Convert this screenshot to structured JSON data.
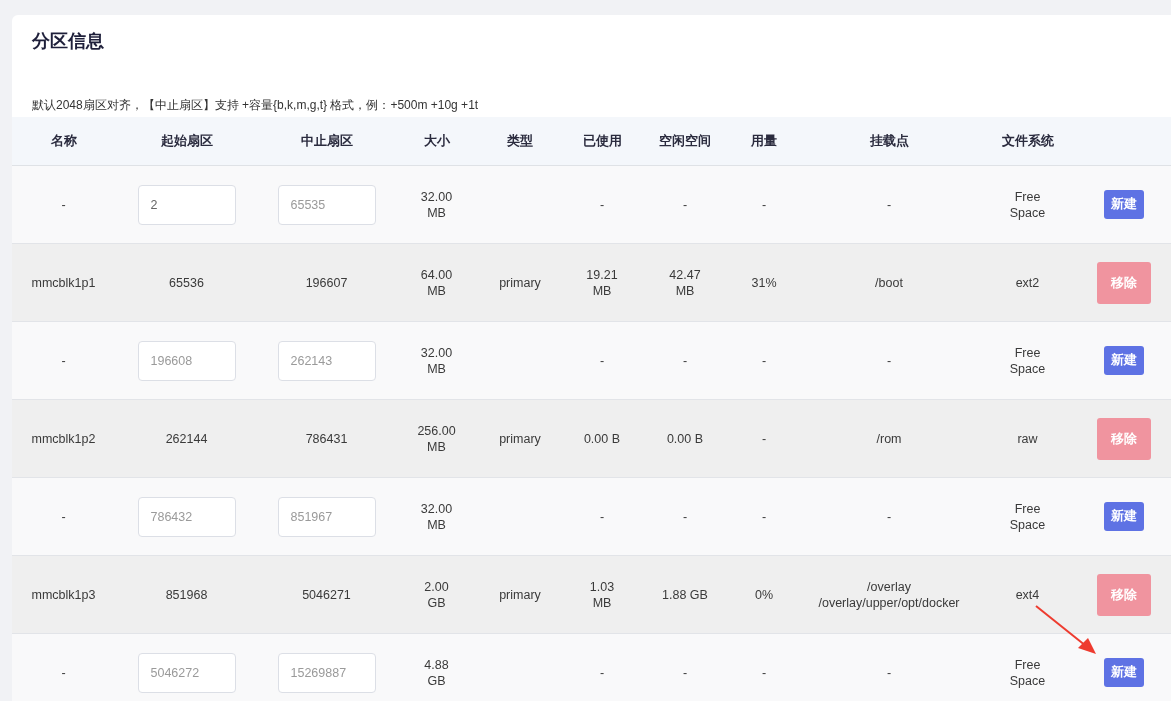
{
  "title": "分区信息",
  "hint": "默认2048扇区对齐，【中止扇区】支持 +容量{b,k,m,g,t} 格式，例：+500m +10g +1t",
  "columns": [
    "名称",
    "起始扇区",
    "中止扇区",
    "大小",
    "类型",
    "已使用",
    "空闲空间",
    "用量",
    "挂载点",
    "文件系统"
  ],
  "rows": [
    {
      "kind": "free",
      "name": "-",
      "start": {
        "value": "2"
      },
      "end": {
        "placeholder": "65535"
      },
      "size": "32.00\nMB",
      "used": "-",
      "free": "-",
      "usage": "-",
      "mount": "-",
      "fs": "Free\nSpace",
      "action": {
        "label": "新建",
        "kind": "new",
        "disabled": false
      }
    },
    {
      "kind": "partition",
      "name": "mmcblk1p1",
      "start": "65536",
      "end": "196607",
      "size": "64.00\nMB",
      "type": "primary",
      "used": "19.21\nMB",
      "free": "42.47\nMB",
      "usage": "31%",
      "mount": "/boot",
      "fs": "ext2",
      "action": {
        "label": "移除",
        "kind": "remove",
        "disabled": true
      }
    },
    {
      "kind": "free",
      "name": "-",
      "start": {
        "placeholder": "196608"
      },
      "end": {
        "placeholder": "262143"
      },
      "size": "32.00\nMB",
      "used": "-",
      "free": "-",
      "usage": "-",
      "mount": "-",
      "fs": "Free\nSpace",
      "action": {
        "label": "新建",
        "kind": "new",
        "disabled": false
      }
    },
    {
      "kind": "partition",
      "name": "mmcblk1p2",
      "start": "262144",
      "end": "786431",
      "size": "256.00\nMB",
      "type": "primary",
      "used": "0.00 B",
      "free": "0.00 B",
      "usage": "-",
      "mount": "/rom",
      "fs": "raw",
      "action": {
        "label": "移除",
        "kind": "remove",
        "disabled": true
      }
    },
    {
      "kind": "free",
      "name": "-",
      "start": {
        "placeholder": "786432"
      },
      "end": {
        "placeholder": "851967"
      },
      "size": "32.00\nMB",
      "used": "-",
      "free": "-",
      "usage": "-",
      "mount": "-",
      "fs": "Free\nSpace",
      "action": {
        "label": "新建",
        "kind": "new",
        "disabled": false
      }
    },
    {
      "kind": "partition",
      "name": "mmcblk1p3",
      "start": "851968",
      "end": "5046271",
      "size": "2.00\nGB",
      "type": "primary",
      "used": "1.03\nMB",
      "free": "1.88 GB",
      "usage": "0%",
      "mount": "/overlay\n/overlay/upper/opt/docker",
      "fs": "ext4",
      "action": {
        "label": "移除",
        "kind": "remove",
        "disabled": true
      }
    },
    {
      "kind": "free",
      "name": "-",
      "start": {
        "placeholder": "5046272"
      },
      "end": {
        "placeholder": "15269887"
      },
      "size": "4.88\nGB",
      "used": "-",
      "free": "-",
      "usage": "-",
      "mount": "-",
      "fs": "Free\nSpace",
      "action": {
        "label": "新建",
        "kind": "new",
        "disabled": false
      }
    }
  ]
}
